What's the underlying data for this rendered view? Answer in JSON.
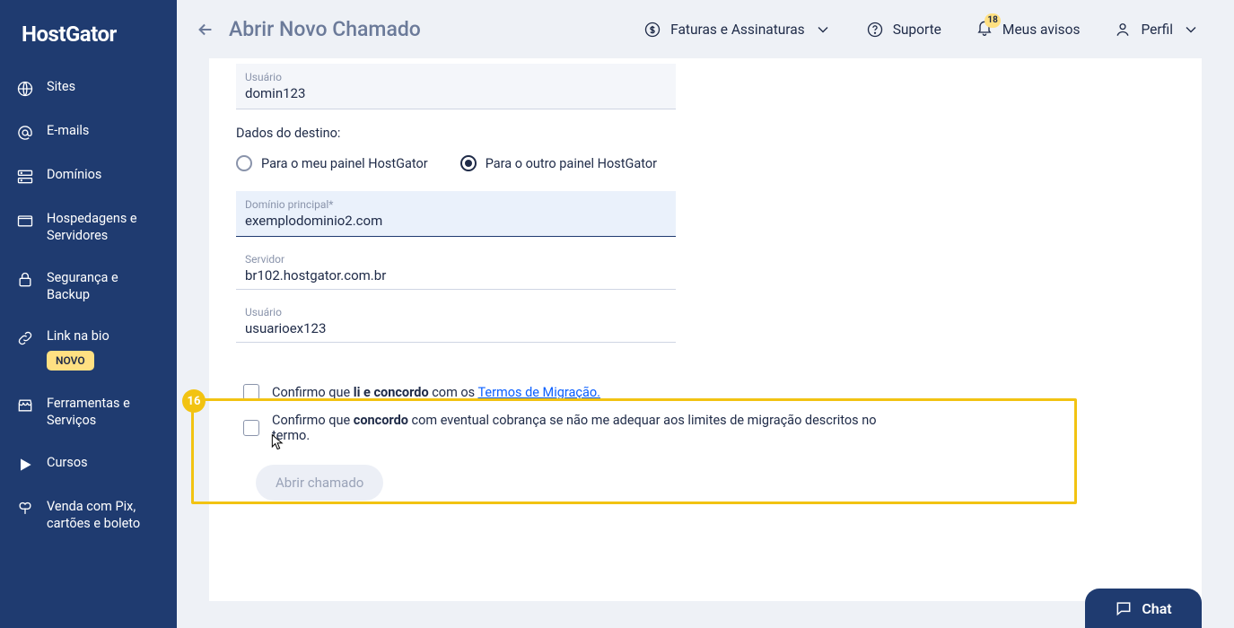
{
  "logo": "HostGator",
  "sidebar": {
    "items": [
      {
        "label": "Sites",
        "icon": "globe-icon"
      },
      {
        "label": "E-mails",
        "icon": "at-icon"
      },
      {
        "label": "Domínios",
        "icon": "server-icon"
      },
      {
        "label": "Hospedagens e Servidores",
        "icon": "folder-icon"
      },
      {
        "label": "Segurança e Backup",
        "icon": "lock-icon"
      },
      {
        "label": "Link na bio",
        "icon": "link-icon",
        "badge": "NOVO"
      },
      {
        "label": "Ferramentas e Serviços",
        "icon": "store-icon"
      },
      {
        "label": "Cursos",
        "icon": "play-icon"
      },
      {
        "label": "Venda com Pix, cartões e boleto",
        "icon": "butterfly-icon"
      }
    ]
  },
  "header": {
    "page_title": "Abrir Novo Chamado",
    "links": {
      "billing": "Faturas e Assinaturas",
      "support": "Suporte",
      "notices": "Meus avisos",
      "profile": "Perfil"
    },
    "notice_count": "18"
  },
  "form": {
    "usuario1_label": "Usuário",
    "usuario1_value": "domin123",
    "section_destino": "Dados do destino:",
    "radio_my_panel": "Para o meu painel HostGator",
    "radio_other_panel": "Para o outro painel HostGator",
    "dominio2_label": "Domínio principal*",
    "dominio2_value": "exemplodominio2.com",
    "servidor_label": "Servidor",
    "servidor_value": "br102.hostgator.com.br",
    "usuario2_label": "Usuário",
    "usuario2_value": "usuarioex123",
    "annotation_number": "16",
    "check1_pre": "Confirmo que ",
    "check1_bold": "li e concordo",
    "check1_mid": " com os ",
    "check1_link": "Termos de Migração.",
    "check2_pre": "Confirmo que ",
    "check2_bold": "concordo",
    "check2_post": " com eventual cobrança se não me adequar aos limites de migração descritos no termo.",
    "submit": "Abrir chamado"
  },
  "chat": {
    "label": "Chat"
  }
}
